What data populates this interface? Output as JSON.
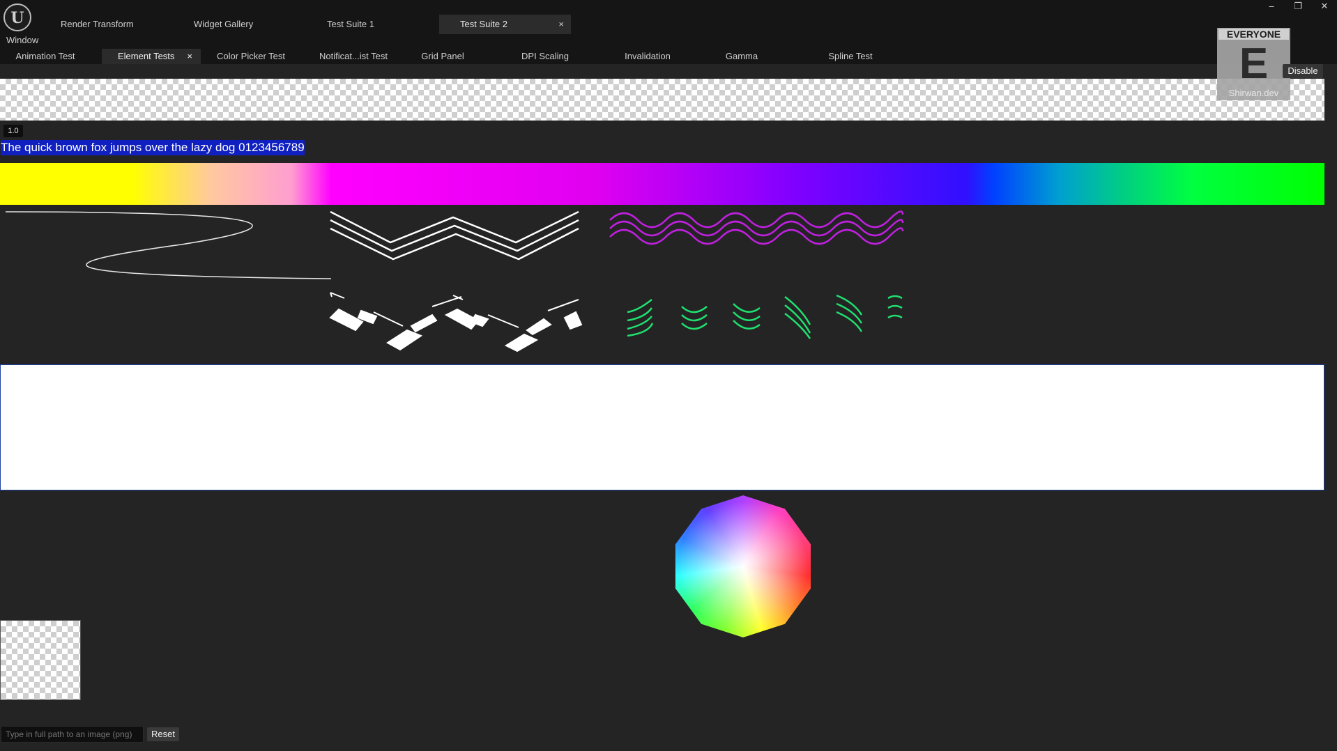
{
  "app": {
    "logo_text": "U",
    "window_menu": "Window"
  },
  "top_tabs": [
    {
      "label": "Render Transform"
    },
    {
      "label": "Widget Gallery"
    },
    {
      "label": "Test Suite 1"
    },
    {
      "label": "Test Suite 2",
      "active": true,
      "close": "×"
    }
  ],
  "window_controls": {
    "minimize": "–",
    "restore": "❐",
    "close": "✕"
  },
  "sub_tabs": [
    {
      "label": "Animation Test"
    },
    {
      "label": "Element Tests",
      "active": true,
      "close": "×"
    },
    {
      "label": "Color Picker Test"
    },
    {
      "label": "Notificat...ist Test"
    },
    {
      "label": "Grid Panel"
    },
    {
      "label": "DPI Scaling"
    },
    {
      "label": "Invalidation"
    },
    {
      "label": "Gamma"
    },
    {
      "label": "Spline Test"
    }
  ],
  "rating_badge": {
    "top": "EVERYONE",
    "letter": "E",
    "bottom": "Shirwan.dev"
  },
  "disable_button": "Disable",
  "scale_badge": "1.0",
  "sample_text": "The quick brown fox jumps over the lazy dog 0123456789",
  "image_path_input": {
    "value": "",
    "placeholder": "Type in full path to an image (png)"
  },
  "reset_button": "Reset",
  "colors": {
    "background": "#242424",
    "titlebar": "#151515",
    "text_highlight": "#1020c0",
    "wave_magenta": "#c020e0",
    "wave_green": "#20e070"
  },
  "icons": {
    "logo": "unreal-logo-icon",
    "tab_close": "close-icon",
    "minimize": "minimize-icon",
    "restore": "restore-icon",
    "close": "close-icon"
  }
}
